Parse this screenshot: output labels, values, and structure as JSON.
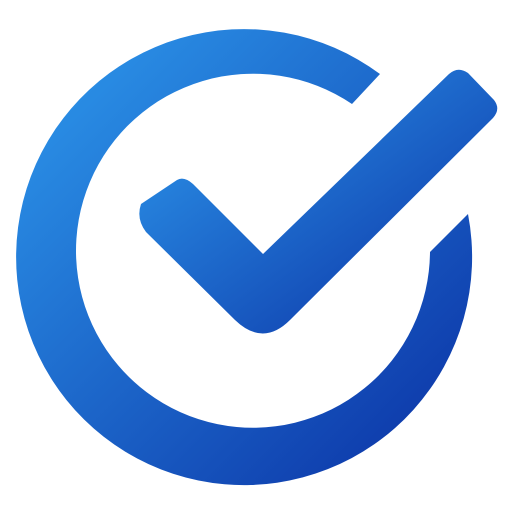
{
  "icon": {
    "name": "check-circle-icon",
    "gradient_start": "#2E9BEE",
    "gradient_end": "#0A2FA3"
  }
}
